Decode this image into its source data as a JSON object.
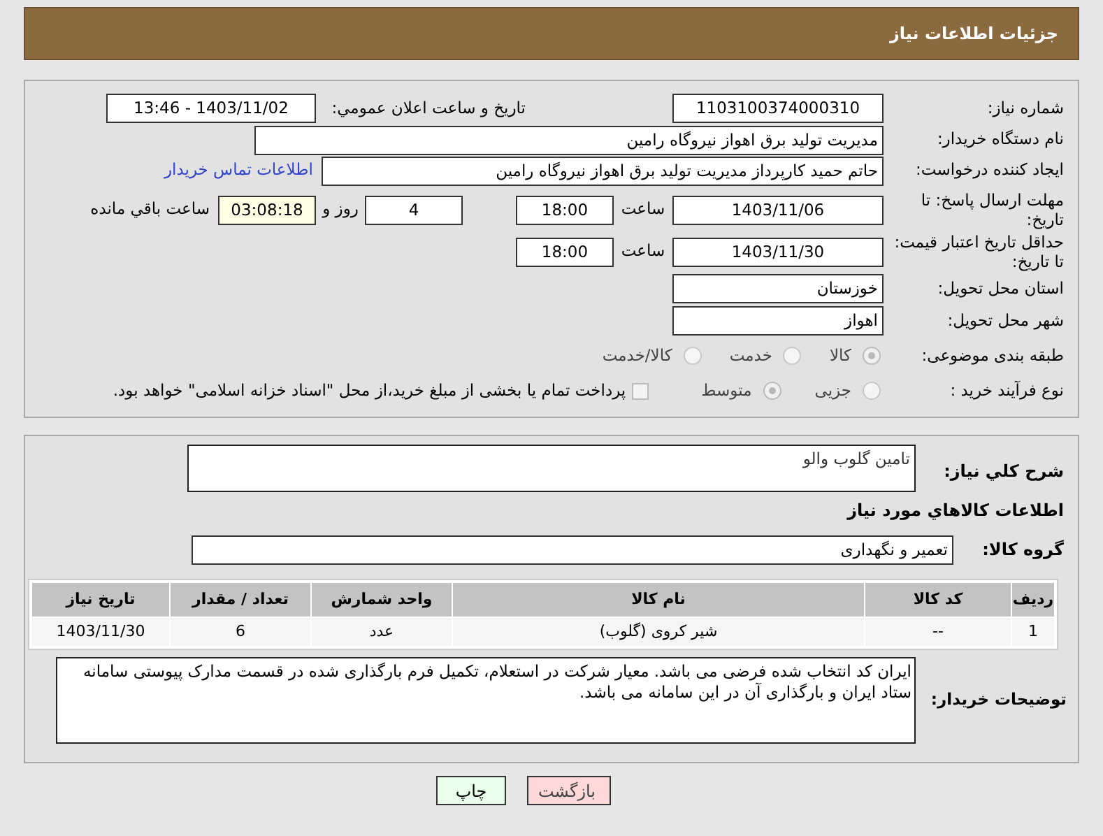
{
  "header": {
    "title": "جزئیات اطلاعات نیاز"
  },
  "need_number": {
    "label": "شماره نیاز:",
    "value": "1103100374000310"
  },
  "announce": {
    "label": "تاریخ و ساعت اعلان عمومي:",
    "value": "1403/11/02 - 13:46"
  },
  "buyer": {
    "label": "نام دستگاه خریدار:",
    "value": "مدیریت تولید برق اهواز نیروگاه رامین"
  },
  "creator": {
    "label": "ایجاد کننده درخواست:",
    "value": "حاتم حمید کارپرداز مدیریت تولید برق اهواز نیروگاه رامین",
    "link": "اطلاعات تماس خریدار"
  },
  "reply_deadline": {
    "label": "مهلت ارسال پاسخ: تا تاریخ:",
    "date": "1403/11/06",
    "time_label": "ساعت",
    "time": "18:00",
    "days": "4",
    "days_label": "روز و",
    "remaining": "03:08:18",
    "remaining_label": "ساعت باقي مانده"
  },
  "price_validity": {
    "label": "حداقل تاریخ اعتبار قیمت: تا تاریخ:",
    "date": "1403/11/30",
    "time_label": "ساعت",
    "time": "18:00"
  },
  "province": {
    "label": "استان محل تحویل:",
    "value": "خوزستان"
  },
  "city": {
    "label": "شهر محل تحویل:",
    "value": "اهواز"
  },
  "category": {
    "label": "طبقه بندی موضوعی:",
    "options": [
      {
        "label": "کالا",
        "selected": true
      },
      {
        "label": "خدمت",
        "selected": false
      },
      {
        "label": "کالا/خدمت",
        "selected": false
      }
    ]
  },
  "purchase_type": {
    "label": "نوع فرآیند خرید :",
    "options": [
      {
        "label": "جزیی",
        "selected": false
      },
      {
        "label": "متوسط",
        "selected": true
      }
    ],
    "payment": {
      "checked": false,
      "text": "پرداخت تمام یا بخشی از مبلغ خرید،از محل \"اسناد خزانه اسلامی\" خواهد بود."
    }
  },
  "description": {
    "label": "شرح كلي نیاز:",
    "value": "تامین گلوب والو"
  },
  "goods_title": "اطلاعات كالاهاي مورد نياز",
  "group": {
    "label": "گروه کالا:",
    "value": "تعمیر و نگهداری"
  },
  "table": {
    "columns": [
      "ردیف",
      "کد کالا",
      "نام کالا",
      "واحد شمارش",
      "تعداد / مقدار",
      "تاریخ نیاز"
    ],
    "rows": [
      [
        "1",
        "--",
        "شیر کروی (گلوب)",
        "عدد",
        "6",
        "1403/11/30"
      ]
    ]
  },
  "notes": {
    "label": "توضیحات خریدار:",
    "value": "ایران کد انتخاب شده فرضی می باشد. معیار شرکت در استعلام، تکمیل فرم بارگذاری شده در قسمت مدارک پیوستی سامانه ستاد ایران و بارگذاری آن در این سامانه می باشد."
  },
  "buttons": [
    {
      "label": "بازگشت",
      "kind": "back"
    },
    {
      "label": "چاپ",
      "kind": "print"
    }
  ]
}
